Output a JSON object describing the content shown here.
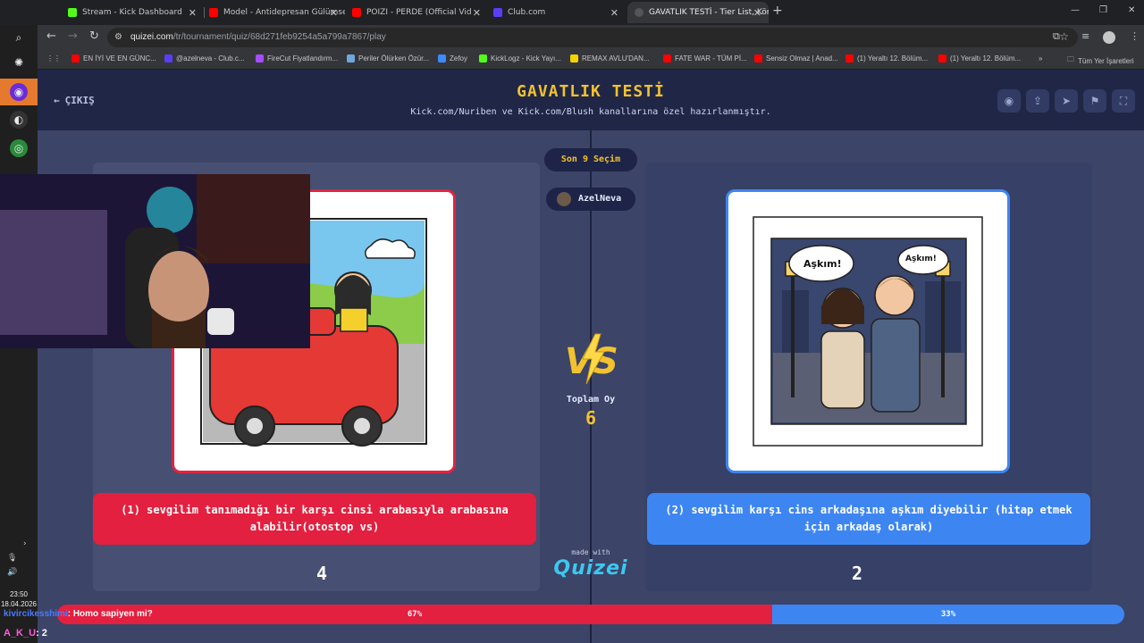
{
  "tabs": [
    {
      "title": "Stream - Kick Dashboard",
      "color": "#53fc18"
    },
    {
      "title": "Model - Antidepresan Gülümse",
      "color": "#ff0000"
    },
    {
      "title": "POIZI - PERDE (Official Vid",
      "color": "#ff0000"
    },
    {
      "title": "Club.com",
      "color": "#5b3df5"
    },
    {
      "title": "GAVATLIK TESTİ - Tier List, Kör S",
      "color": "#3b3b3b",
      "active": true
    }
  ],
  "address": {
    "host": "quizei.com",
    "path": "/tr/tournament/quiz/68d271feb9254a5a799a7867/play"
  },
  "bookmarks": [
    "EN İYİ VE EN GÜNC...",
    "@azelneva - Club.c...",
    "FireCut Fiyatlandırm...",
    "Periler Ölürken Özür...",
    "Zefoy",
    "KickLogz - Kick Yayı...",
    "REMAX AVLU'DAN...",
    "FATE WAR - TÜM Pİ...",
    "Sensiz Olmaz | Anad...",
    "(1) Yeraltı 12. Bölüm...",
    "(1) Yeraltı 12. Bölüm..."
  ],
  "bookmarks_all": "Tüm Yer İşaretleri",
  "quiz": {
    "exit_label": "ÇIKIŞ",
    "title": "GAVATLIK TESTİ",
    "subtitle": "Kick.com/Nuriben ve Kick.com/Blush kanallarına özel hazırlanmıştır.",
    "round_label": "Son 9 Seçim",
    "creator": "AzelNeva",
    "total_label": "Toplam Oy",
    "total_value": "6",
    "made_with": "made with",
    "brand": "Quizei",
    "left": {
      "text": "(1) sevgilim tanımadığı bir karşı cinsi arabasıyla arabasına alabilir(otostop vs)",
      "votes": "4",
      "percent_label": "67%",
      "share": 0.67
    },
    "right": {
      "text": "(2) sevgilim karşı cins arkadaşına aşkım diyebilir (hitap etmek için arkadaş olarak)",
      "votes": "2",
      "percent_label": "33%",
      "share": 0.33,
      "bubble_left": "Aşkım!",
      "bubble_right": "Aşkım!"
    }
  },
  "chat": {
    "user": "kivircikesshimi",
    "message": ": Homo sapiyen mi?"
  },
  "overlay_handle": {
    "name": "A_K_U",
    "suffix": ": 2"
  },
  "clock": {
    "time": "23:50",
    "date": "18.04.2026"
  }
}
